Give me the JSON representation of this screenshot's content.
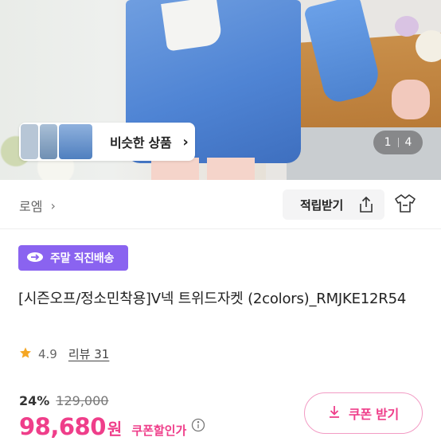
{
  "gallery": {
    "similar_label": "비슷한 상품",
    "current_index": "1",
    "total_count": "4"
  },
  "brand": {
    "name": "로엠"
  },
  "actions": {
    "points_label": "적립받기"
  },
  "delivery_badge": {
    "label": "주말 직진배송"
  },
  "product": {
    "title": "[시즌오프/정소민착용]V넥 트위드자켓 (2colors)_RMJKE12R54",
    "rating": "4.9",
    "reviews_label": "리뷰 31"
  },
  "price": {
    "discount_rate": "24%",
    "original": "129,000",
    "final": "98,680",
    "currency": "원",
    "coupon_note": "쿠폰할인가"
  },
  "coupon_button": {
    "label": "쿠폰 받기"
  },
  "colors": {
    "accent_pink": "#ef3e8a",
    "badge_purple": "#8a63f0",
    "star": "#f5a623"
  },
  "icons": [
    "chevron-right-icon",
    "share-icon",
    "hanger-icon",
    "delivery-icon",
    "star-icon",
    "info-icon",
    "download-icon"
  ]
}
